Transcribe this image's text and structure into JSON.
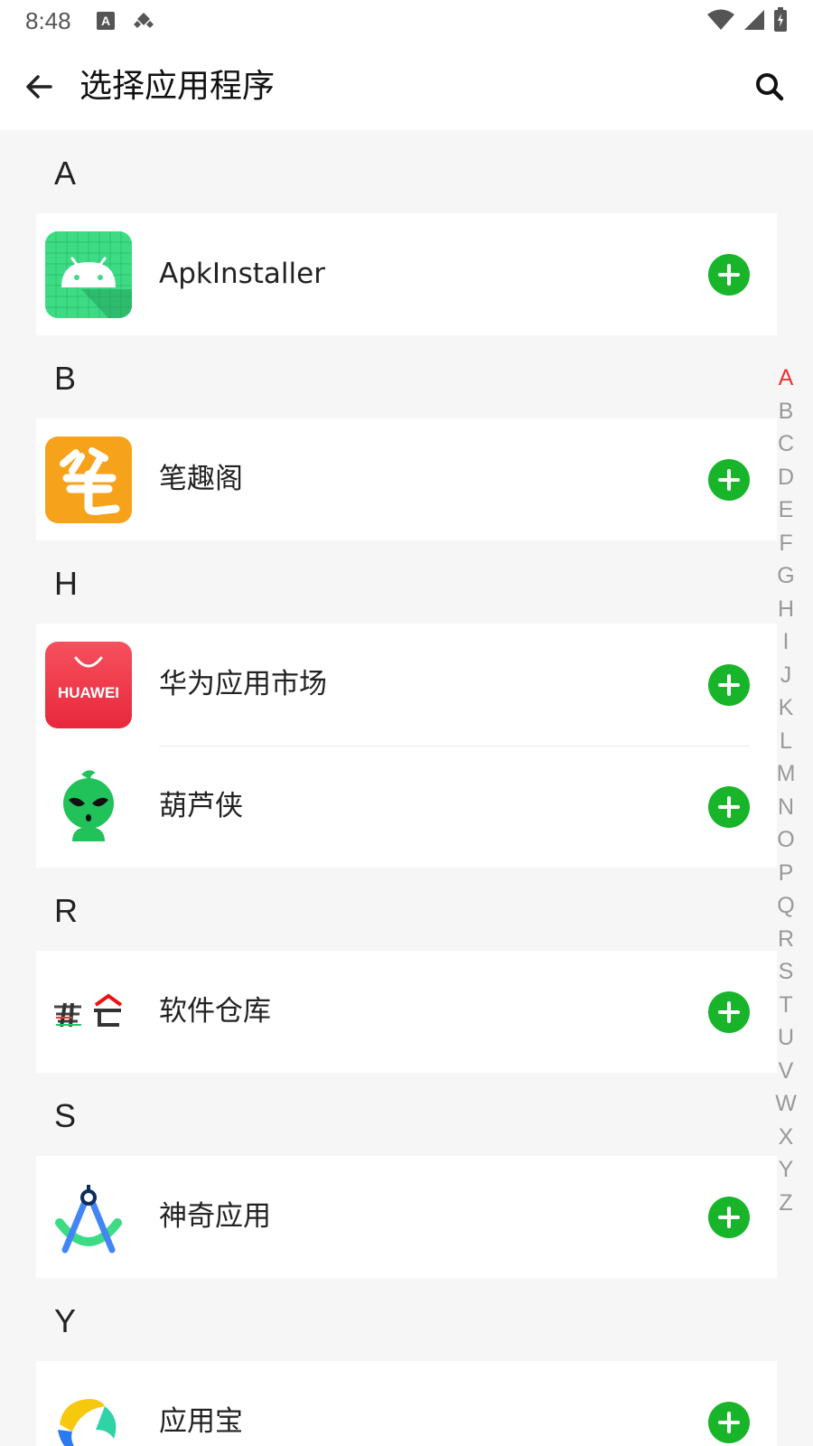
{
  "status_bar": {
    "time": "8:48"
  },
  "toolbar": {
    "title": "选择应用程序"
  },
  "sections": [
    {
      "letter": "A",
      "apps": [
        {
          "name": "ApkInstaller",
          "icon": "android-grid-icon"
        }
      ]
    },
    {
      "letter": "B",
      "apps": [
        {
          "name": "笔趣阁",
          "icon": "biquge-icon"
        }
      ]
    },
    {
      "letter": "H",
      "apps": [
        {
          "name": "华为应用市场",
          "icon": "huawei-appgallery-icon",
          "icon_text": "HUAWEI"
        },
        {
          "name": "葫芦侠",
          "icon": "huluxia-icon"
        }
      ]
    },
    {
      "letter": "R",
      "apps": [
        {
          "name": "软件仓库",
          "icon": "ruancang-icon"
        }
      ]
    },
    {
      "letter": "S",
      "apps": [
        {
          "name": "神奇应用",
          "icon": "android-studio-icon"
        }
      ]
    },
    {
      "letter": "Y",
      "apps": [
        {
          "name": "应用宝",
          "icon": "yingyongbao-icon"
        }
      ]
    }
  ],
  "alphabet_index": [
    "A",
    "B",
    "C",
    "D",
    "E",
    "F",
    "G",
    "H",
    "I",
    "J",
    "K",
    "L",
    "M",
    "N",
    "O",
    "P",
    "Q",
    "R",
    "S",
    "T",
    "U",
    "V",
    "W",
    "X",
    "Y",
    "Z"
  ],
  "alphabet_active": "A",
  "colors": {
    "accent_add": "#18b52a",
    "index_active": "#e33333",
    "huawei_red": "#e8283c",
    "biquge_orange": "#f7a21b"
  }
}
